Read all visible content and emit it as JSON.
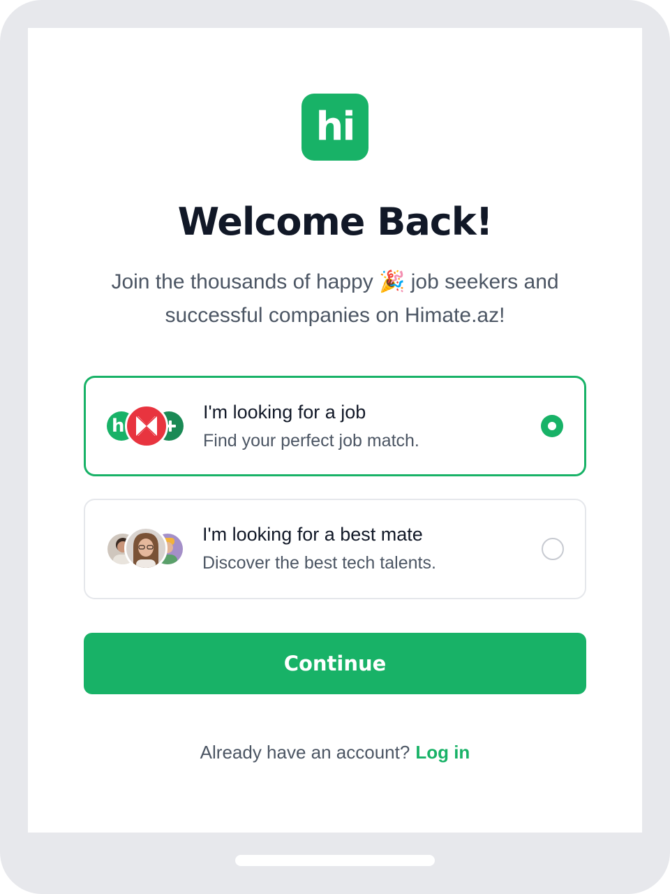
{
  "logo": {
    "text": "hi"
  },
  "title": "Welcome Back!",
  "subtitle": {
    "before_emoji": "Join the thousands of happy ",
    "emoji": "🎉",
    "after_emoji": " job seekers and successful companies on Himate.az!"
  },
  "options": [
    {
      "title": "I'm looking for a job",
      "description": "Find your perfect job match.",
      "selected": true
    },
    {
      "title": "I'm looking for a best mate",
      "description": "Discover the best tech talents.",
      "selected": false
    }
  ],
  "continue_label": "Continue",
  "footer": {
    "prompt": "Already have an account?",
    "login_label": "Log in"
  },
  "colors": {
    "brand_green": "#18b267",
    "frame_gray": "#e7e8ec",
    "heading": "#111827",
    "body_text": "#4b5563"
  }
}
